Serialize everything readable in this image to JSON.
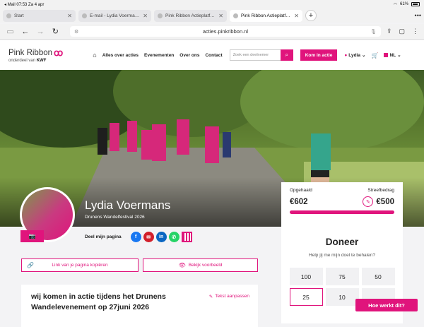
{
  "status_bar": {
    "left": "◂ Mail  07:53  Za 4 apr",
    "battery": "61%"
  },
  "tabs": [
    {
      "label": "Start",
      "active": false
    },
    {
      "label": "E-mail - Lydia Voermans - Outlook",
      "active": false
    },
    {
      "label": "Pink Ribbon Actieplatform",
      "active": false
    },
    {
      "label": "Pink Ribbon Actieplatform",
      "active": true
    }
  ],
  "address": {
    "url": "acties.pinkribbon.nl"
  },
  "header": {
    "logo_text": "Pink Ribbon",
    "logo_sub_prefix": "onderdeel van",
    "logo_sub_brand": "KWF",
    "nav": [
      "Alles over acties",
      "Evenementen",
      "Over ons",
      "Contact"
    ],
    "search_placeholder": "Zoek een deelnemer",
    "cta": "Kom in actie",
    "user": "Lydia",
    "lang": "NL"
  },
  "hero": {
    "name": "Lydia Voermans",
    "event": "Drunens Wandelfestival 2026"
  },
  "share": {
    "label": "Deel mijn pagina"
  },
  "buttons": {
    "copy_link": "Link van je pagina kopiëren",
    "preview": "Bekijk voorbeeld"
  },
  "story": {
    "title": "wij komen in actie tijdens het Drunens Wandelevenement op 27juni 2026",
    "edit": "Tekst aanpassen"
  },
  "donation": {
    "raised_label": "Opgehaald",
    "goal_label": "Streefbedrag",
    "raised": "€602",
    "goal": "€500",
    "progress": 1.0,
    "title": "Doneer",
    "question": "Help jij me mijn doel te behalen?",
    "amounts": [
      "100",
      "75",
      "50",
      "25",
      "10",
      ""
    ]
  },
  "help": "Hoe werkt dit?",
  "colors": {
    "brand": "#e0147c"
  }
}
